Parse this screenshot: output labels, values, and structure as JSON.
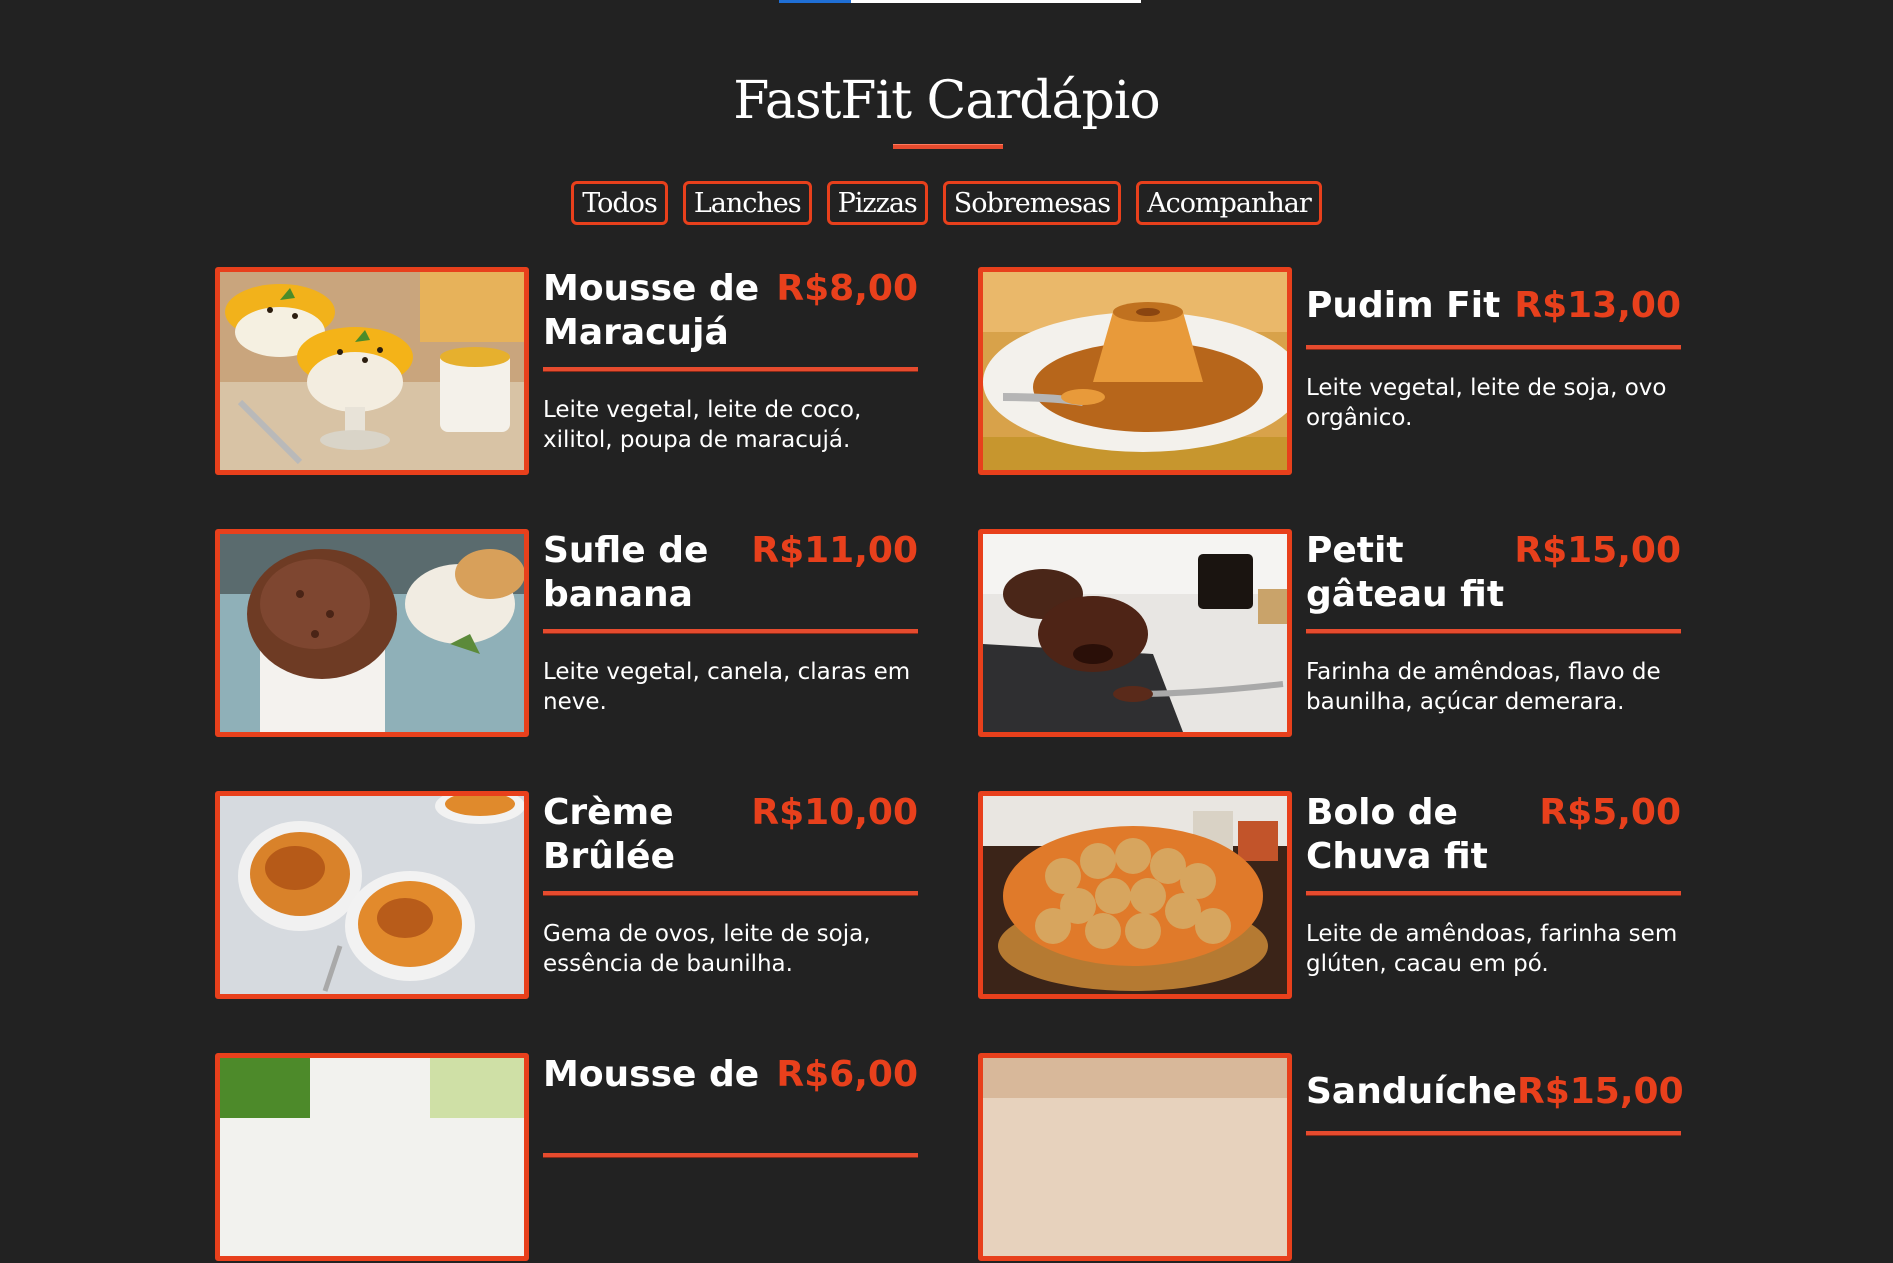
{
  "title": "FastFit Cardápio",
  "loading_progress": 0.2,
  "colors": {
    "background": "#222222",
    "accent": "#e8401c",
    "progress": "#1f6fd6"
  },
  "filters": [
    {
      "label": "Todos",
      "icon": ""
    },
    {
      "label": "Lanches"
    },
    {
      "label": "Pizzas"
    },
    {
      "label": "Sobremesas"
    },
    {
      "label": "Acompanhar"
    }
  ],
  "items": [
    {
      "name": "Mousse de Maracujá",
      "price": "R$8,00",
      "description": "Leite vegetal, leite de coco, xilitol, poupa de maracujá.",
      "image": "passion-fruit-mousse-photo"
    },
    {
      "name": "Pudim Fit",
      "price": "R$13,00",
      "description": "Leite vegetal, leite de soja, ovo orgânico.",
      "image": "flan-pudding-photo"
    },
    {
      "name": "Sufle de banana",
      "price": "R$11,00",
      "description": "Leite vegetal, canela, claras em neve.",
      "image": "banana-souffle-photo"
    },
    {
      "name": "Petit gâteau fit",
      "price": "R$15,00",
      "description": "Farinha de amêndoas, flavo de baunilha, açúcar demerara.",
      "image": "petit-gateau-photo"
    },
    {
      "name": "Crème Brûlée",
      "price": "R$10,00",
      "description": "Gema de ovos, leite de soja, essência de baunilha.",
      "image": "creme-brulee-photo"
    },
    {
      "name": "Bolo de Chuva fit",
      "price": "R$5,00",
      "description": "Leite de amêndoas, farinha sem glúten, cacau em pó.",
      "image": "rain-cake-photo"
    },
    {
      "name": "Mousse de",
      "price": "R$6,00",
      "description": "",
      "image": "mousse-photo"
    },
    {
      "name": "Sanduíche",
      "price": "R$15,00",
      "description": "",
      "image": "sandwich-photo"
    }
  ]
}
